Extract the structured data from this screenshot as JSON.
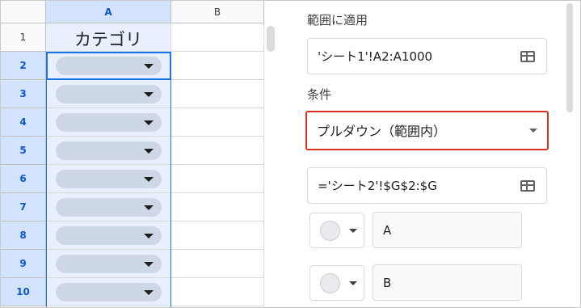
{
  "sheet": {
    "columns": [
      "A",
      "B"
    ],
    "rows": [
      "1",
      "2",
      "3",
      "4",
      "5",
      "6",
      "7",
      "8",
      "9",
      "10"
    ],
    "header_cell": "カテゴリ"
  },
  "panel": {
    "range_label": "範囲に適用",
    "range_value": "'シート1'!A2:A1000",
    "criteria_label": "条件",
    "criteria_value": "プルダウン（範囲内）",
    "source_value": "='シート2'!$G$2:$G",
    "items": [
      {
        "value": "A"
      },
      {
        "value": "B"
      }
    ]
  },
  "colors": {
    "selection": "#1a73e8",
    "highlight_border": "#d93025",
    "chip": "#cdd7e6"
  }
}
